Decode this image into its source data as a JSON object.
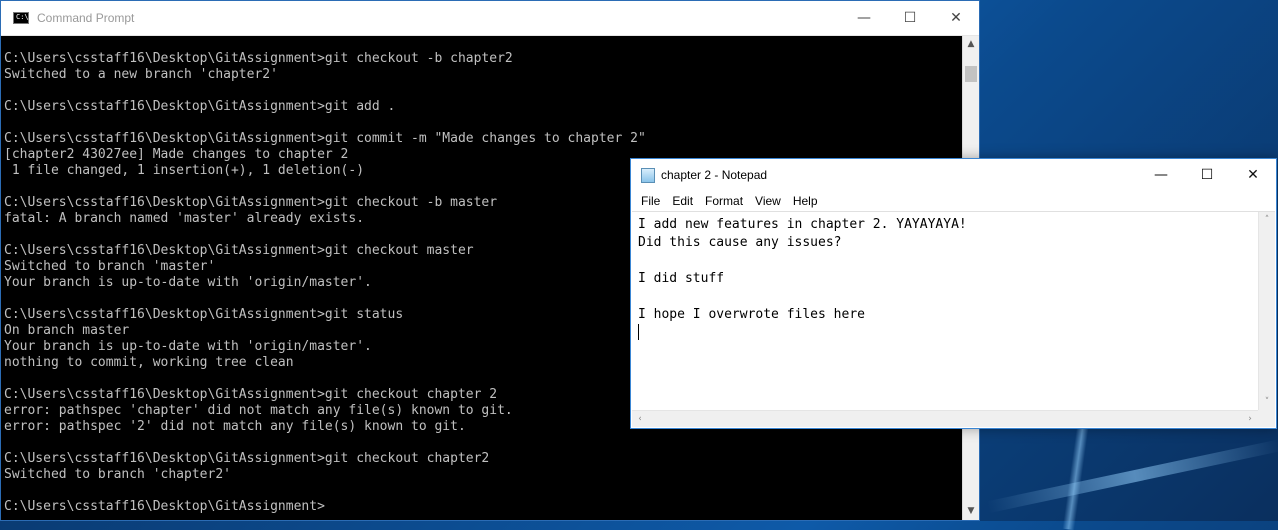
{
  "cmd": {
    "title": "Command Prompt",
    "icon_text": "C:\\",
    "lines": [
      "C:\\Users\\csstaff16\\Desktop\\GitAssignment>git checkout -b chapter2",
      "Switched to a new branch 'chapter2'",
      "",
      "C:\\Users\\csstaff16\\Desktop\\GitAssignment>git add .",
      "",
      "C:\\Users\\csstaff16\\Desktop\\GitAssignment>git commit -m \"Made changes to chapter 2\"",
      "[chapter2 43027ee] Made changes to chapter 2",
      " 1 file changed, 1 insertion(+), 1 deletion(-)",
      "",
      "C:\\Users\\csstaff16\\Desktop\\GitAssignment>git checkout -b master",
      "fatal: A branch named 'master' already exists.",
      "",
      "C:\\Users\\csstaff16\\Desktop\\GitAssignment>git checkout master",
      "Switched to branch 'master'",
      "Your branch is up-to-date with 'origin/master'.",
      "",
      "C:\\Users\\csstaff16\\Desktop\\GitAssignment>git status",
      "On branch master",
      "Your branch is up-to-date with 'origin/master'.",
      "nothing to commit, working tree clean",
      "",
      "C:\\Users\\csstaff16\\Desktop\\GitAssignment>git checkout chapter 2",
      "error: pathspec 'chapter' did not match any file(s) known to git.",
      "error: pathspec '2' did not match any file(s) known to git.",
      "",
      "C:\\Users\\csstaff16\\Desktop\\GitAssignment>git checkout chapter2",
      "Switched to branch 'chapter2'",
      "",
      "C:\\Users\\csstaff16\\Desktop\\GitAssignment>"
    ],
    "buttons": {
      "minimize": "—",
      "maximize": "☐",
      "close": "✕"
    }
  },
  "notepad": {
    "title": "chapter 2 - Notepad",
    "menu": [
      "File",
      "Edit",
      "Format",
      "View",
      "Help"
    ],
    "lines": [
      "I add new features in chapter 2. YAYAYAYA!",
      "Did this cause any issues?",
      "",
      "I did stuff",
      "",
      "I hope I overwrote files here"
    ],
    "buttons": {
      "minimize": "—",
      "maximize": "☐",
      "close": "✕"
    }
  },
  "colors": {
    "console_bg": "#000000",
    "console_fg": "#c0c0c0",
    "desktop_accent": "#0e5aa8"
  }
}
